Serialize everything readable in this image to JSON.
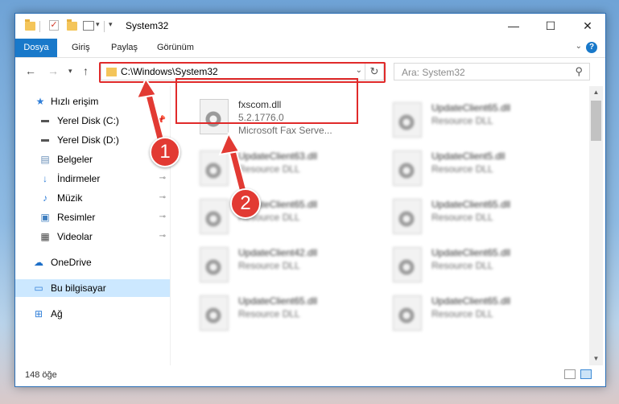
{
  "window": {
    "title": "System32",
    "controls": {
      "minimize": "—",
      "maximize": "☐",
      "close": "✕"
    }
  },
  "ribbon": {
    "tabs": [
      "Dosya",
      "Giriş",
      "Paylaş",
      "Görünüm"
    ]
  },
  "nav": {
    "address": "C:\\Windows\\System32",
    "search_placeholder": "Ara: System32"
  },
  "sidebar": {
    "items": [
      {
        "label": "Hızlı erişim",
        "icon": "star-icon"
      },
      {
        "label": "Yerel Disk (C:)",
        "icon": "drive-icon"
      },
      {
        "label": "Yerel Disk (D:)",
        "icon": "drive-icon"
      },
      {
        "label": "Belgeler",
        "icon": "documents-icon"
      },
      {
        "label": "İndirmeler",
        "icon": "download-icon"
      },
      {
        "label": "Müzik",
        "icon": "music-icon"
      },
      {
        "label": "Resimler",
        "icon": "pictures-icon"
      },
      {
        "label": "Videolar",
        "icon": "videos-icon"
      },
      {
        "label": "OneDrive",
        "icon": "onedrive-icon"
      },
      {
        "label": "Bu bilgisayar",
        "icon": "computer-icon"
      },
      {
        "label": "Ağ",
        "icon": "network-icon"
      }
    ]
  },
  "files": {
    "highlighted": {
      "name": "fxscom.dll",
      "version": "5.2.1776.0",
      "description": "Microsoft Fax Serve..."
    },
    "others": [
      {
        "name": "UpdateClient65.dll",
        "type": "Resource DLL"
      },
      {
        "name": "UpdateClient63.dll",
        "type": "Resource DLL"
      },
      {
        "name": "UpdateClient5.dll",
        "type": "Resource DLL"
      },
      {
        "name": "UpdateClient65.dll",
        "type": "Resource DLL"
      },
      {
        "name": "UpdateClient65.dll",
        "type": "Resource DLL"
      },
      {
        "name": "UpdateClient42.dll",
        "type": "Resource DLL"
      },
      {
        "name": "UpdateClient65.dll",
        "type": "Resource DLL"
      },
      {
        "name": "UpdateClient65.dll",
        "type": "Resource DLL"
      },
      {
        "name": "UpdateClient65.dll",
        "type": "Resource DLL"
      }
    ]
  },
  "status": {
    "item_count": "148 öğe"
  },
  "annotations": {
    "step1": "1",
    "step2": "2",
    "color": "#e23a33"
  }
}
